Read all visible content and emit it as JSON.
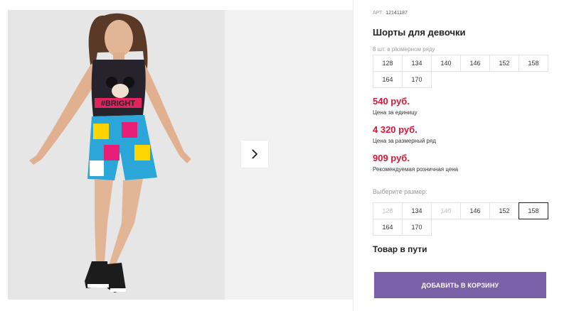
{
  "gallery": {
    "next_icon": "chevron-right-icon"
  },
  "product": {
    "article_label": "АРТ:",
    "article_value": "12141187",
    "title": "Шорты для девочки",
    "size_row_caption": "8 шт. в размерном ряду",
    "size_row": [
      "128",
      "134",
      "140",
      "146",
      "152",
      "158",
      "164",
      "170"
    ],
    "prices": [
      {
        "value": "540 руб.",
        "caption": "Цена за единицу"
      },
      {
        "value": "4 320 руб.",
        "caption": "Цена за размерный ряд"
      },
      {
        "value": "909 руб.",
        "caption": "Рекомендуемая розничная цена"
      }
    ],
    "select_size_caption": "Выберите размер:",
    "select_sizes": [
      {
        "label": "128",
        "available": false,
        "selected": false
      },
      {
        "label": "134",
        "available": true,
        "selected": false
      },
      {
        "label": "140",
        "available": false,
        "selected": false
      },
      {
        "label": "146",
        "available": true,
        "selected": false
      },
      {
        "label": "152",
        "available": true,
        "selected": false
      },
      {
        "label": "158",
        "available": true,
        "selected": true
      },
      {
        "label": "164",
        "available": true,
        "selected": false
      },
      {
        "label": "170",
        "available": true,
        "selected": false
      }
    ],
    "status": "Товар в пути",
    "add_to_cart": "ДОБАВИТЬ В КОРЗИНУ"
  },
  "colors": {
    "price": "#d0193a",
    "button": "#7b62a8"
  }
}
